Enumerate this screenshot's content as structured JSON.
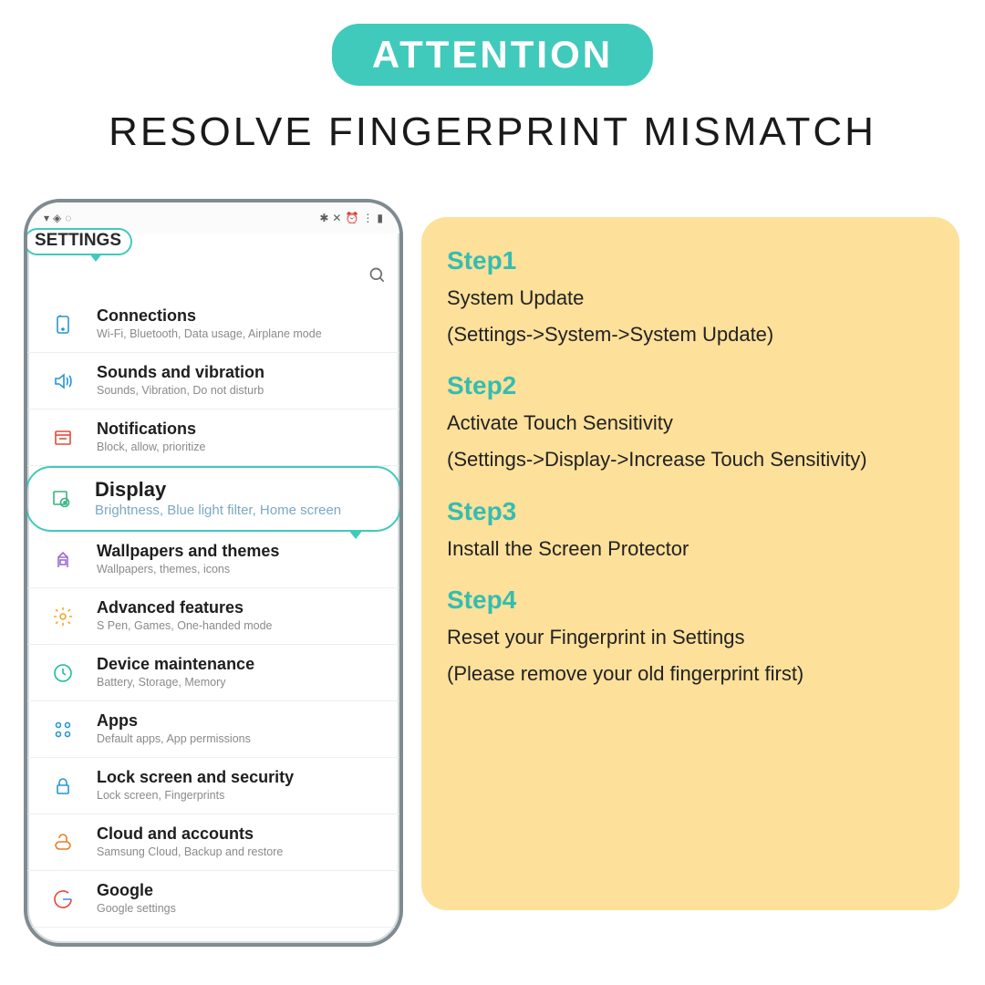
{
  "header": {
    "pill": "ATTENTION",
    "title": "RESOLVE FINGERPRINT MISMATCH"
  },
  "phone": {
    "callout": "SETTINGS",
    "items": [
      {
        "title": "Connections",
        "sub": "Wi-Fi, Bluetooth, Data usage, Airplane mode"
      },
      {
        "title": "Sounds and vibration",
        "sub": "Sounds, Vibration, Do not disturb"
      },
      {
        "title": "Notifications",
        "sub": "Block, allow, prioritize"
      },
      {
        "title": "Display",
        "sub": "Brightness, Blue light filter, Home screen"
      },
      {
        "title": "Wallpapers and themes",
        "sub": "Wallpapers, themes, icons"
      },
      {
        "title": "Advanced features",
        "sub": "S Pen, Games, One-handed mode"
      },
      {
        "title": "Device maintenance",
        "sub": "Battery, Storage, Memory"
      },
      {
        "title": "Apps",
        "sub": "Default apps, App permissions"
      },
      {
        "title": "Lock screen and security",
        "sub": "Lock screen, Fingerprints"
      },
      {
        "title": "Cloud and accounts",
        "sub": "Samsung Cloud, Backup and restore"
      },
      {
        "title": "Google",
        "sub": "Google settings"
      }
    ]
  },
  "steps": [
    {
      "title": "Step1",
      "line": "System Update",
      "note": "(Settings->System->System Update)"
    },
    {
      "title": "Step2",
      "line": "Activate Touch Sensitivity",
      "note": "(Settings->Display->Increase Touch Sensitivity)"
    },
    {
      "title": "Step3",
      "line": "Install the Screen Protector",
      "note": ""
    },
    {
      "title": "Step4",
      "line": "Reset your Fingerprint in Settings",
      "note": "(Please remove your old fingerprint first)"
    }
  ]
}
